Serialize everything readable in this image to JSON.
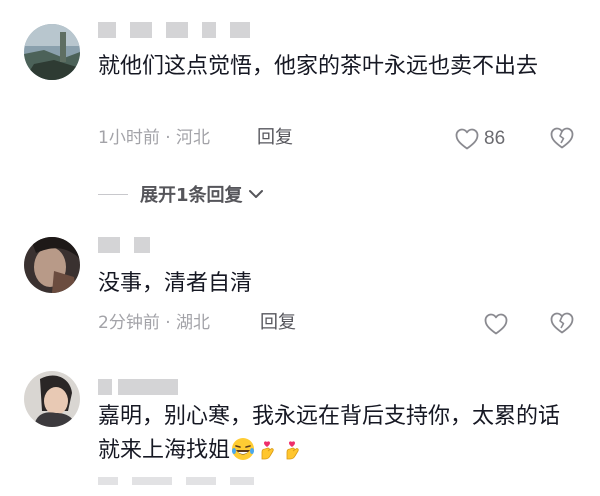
{
  "comments": [
    {
      "username": "",
      "text": "就他们这点觉悟，他家的茶叶永远也卖不出去",
      "time_location": "1小时前 · 河北",
      "reply_label": "回复",
      "likes": "86"
    },
    {
      "username": "",
      "text": "没事，清者自清",
      "time_location": "2分钟前 · 湖北",
      "reply_label": "回复",
      "likes": ""
    },
    {
      "username": "",
      "text": "嘉明，别心寒，我永远在背后支持你，太累的话就来上海找姐",
      "time_location": "",
      "reply_label": "",
      "likes": ""
    }
  ],
  "expand_replies": {
    "label": "展开1条回复"
  },
  "icons": {
    "like": "heart-outline-icon",
    "dislike": "broken-heart-icon",
    "expand": "chevron-down-icon",
    "emojis": [
      "laughing-tears-emoji",
      "finger-heart-emoji",
      "finger-heart-emoji"
    ]
  },
  "colors": {
    "text_primary": "#161823",
    "text_secondary": "#a3a3a8",
    "icon_gray": "#8a8a90"
  }
}
